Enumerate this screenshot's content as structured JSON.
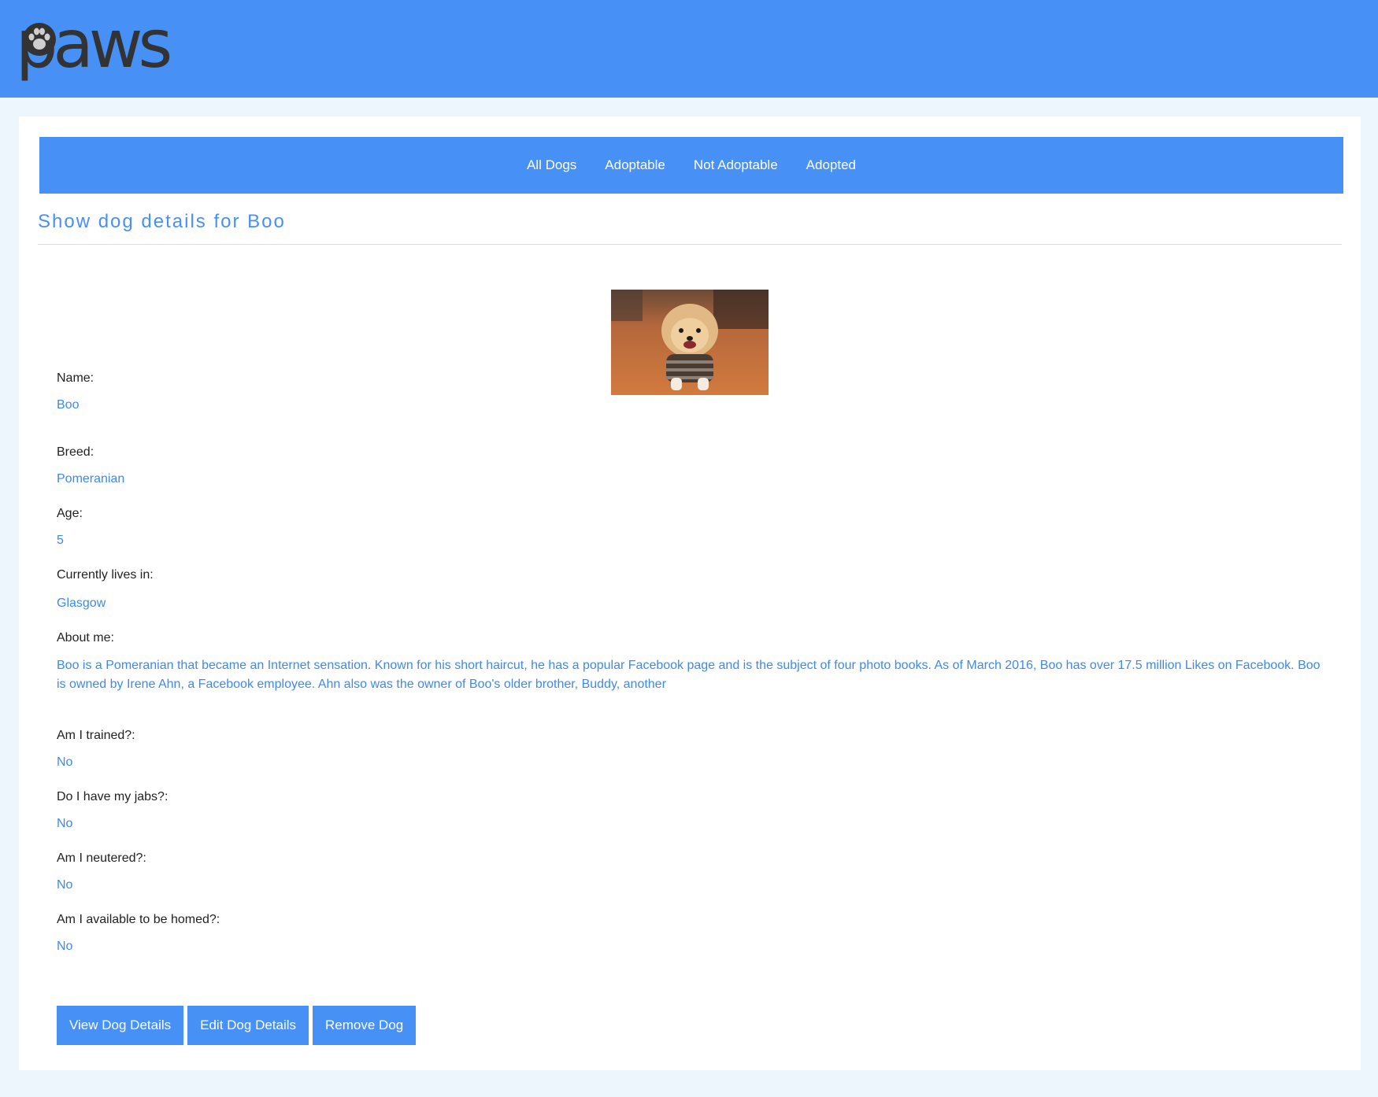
{
  "header": {
    "logo_text": "paws"
  },
  "nav": {
    "items": [
      {
        "label": "All Dogs"
      },
      {
        "label": "Adoptable"
      },
      {
        "label": "Not Adoptable"
      },
      {
        "label": "Adopted"
      }
    ]
  },
  "page": {
    "title": "Show dog details for Boo"
  },
  "dog": {
    "photo_icon": "pomeranian-dog-photo",
    "fields": {
      "name_label": "Name:",
      "name_value": "Boo",
      "breed_label": "Breed:",
      "breed_value": "Pomeranian",
      "age_label": "Age:",
      "age_value": "5",
      "location_label": "Currently lives in:",
      "location_value": "Glasgow",
      "about_label": "About me:",
      "about_value": "Boo is a Pomeranian that became an Internet sensation. Known for his short haircut, he has a popular Facebook page and is the subject of four photo books. As of March 2016, Boo has over 17.5 million Likes on Facebook. Boo is owned by Irene Ahn, a Facebook employee. Ahn also was the owner of Boo's older brother, Buddy, another",
      "trained_label": "Am I trained?:",
      "trained_value": "No",
      "jabs_label": "Do I have my jabs?:",
      "jabs_value": "No",
      "neutered_label": "Am I neutered?:",
      "neutered_value": "No",
      "available_label": "Am I available to be homed?:",
      "available_value": "No"
    }
  },
  "actions": {
    "view_label": "View Dog Details",
    "edit_label": "Edit Dog Details",
    "remove_label": "Remove Dog"
  },
  "colors": {
    "primary": "#4790f6",
    "value_text": "#3f8ae8",
    "page_bg": "#eef6fd"
  }
}
